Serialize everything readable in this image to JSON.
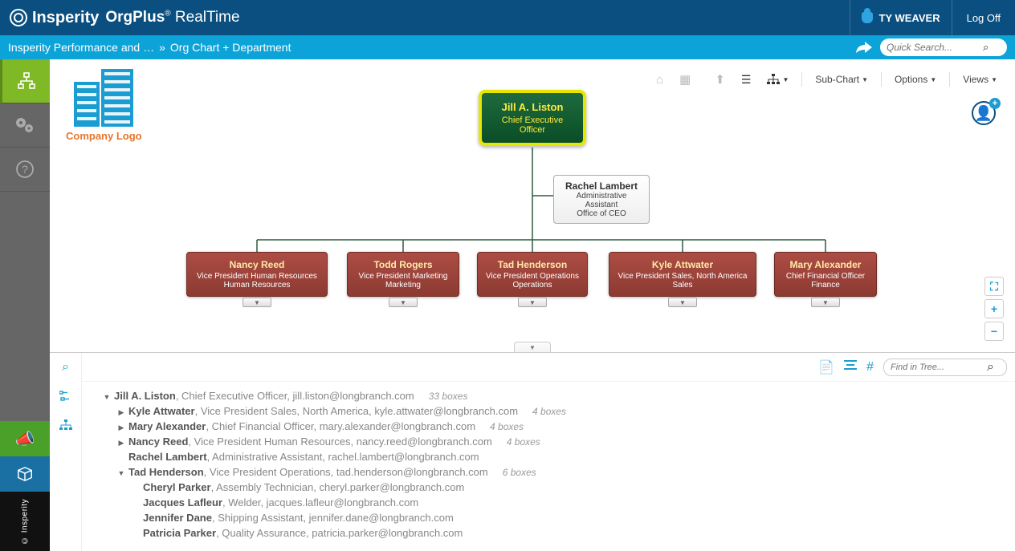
{
  "header": {
    "brand_main": "Insperity",
    "brand_product": "OrgPlus",
    "brand_suffix": "RealTime",
    "user_name": "TY WEAVER",
    "logoff": "Log Off"
  },
  "breadcrumb": {
    "item1": "Insperity Performance and …",
    "sep": "»",
    "item2": "Org Chart + Department"
  },
  "search": {
    "placeholder": "Quick Search..."
  },
  "logo_text": "Company Logo",
  "toolbar": {
    "subchart": "Sub-Chart",
    "options": "Options",
    "views": "Views"
  },
  "org": {
    "ceo": {
      "name": "Jill A. Liston",
      "title": "Chief Executive Officer"
    },
    "assistant": {
      "name": "Rachel Lambert",
      "title": "Administrative Assistant",
      "dept": "Office of CEO"
    },
    "vps": [
      {
        "name": "Nancy Reed",
        "title": "Vice President Human Resources",
        "dept": "Human Resources"
      },
      {
        "name": "Todd Rogers",
        "title": "Vice President Marketing",
        "dept": "Marketing"
      },
      {
        "name": "Tad Henderson",
        "title": "Vice President Operations",
        "dept": "Operations"
      },
      {
        "name": "Kyle Attwater",
        "title": "Vice President Sales, North America",
        "dept": "Sales"
      },
      {
        "name": "Mary Alexander",
        "title": "Chief Financial Officer",
        "dept": "Finance"
      }
    ]
  },
  "tree": {
    "search_placeholder": "Find in Tree...",
    "rows": [
      {
        "indent": 1,
        "arrow": "▼",
        "name": "Jill A. Liston",
        "details": ", Chief Executive Officer, jill.liston@longbranch.com",
        "boxes": "33 boxes"
      },
      {
        "indent": 2,
        "arrow": "▶",
        "name": "Kyle Attwater",
        "details": ", Vice President Sales, North America, kyle.attwater@longbranch.com",
        "boxes": "4 boxes"
      },
      {
        "indent": 2,
        "arrow": "▶",
        "name": "Mary Alexander",
        "details": ", Chief Financial Officer, mary.alexander@longbranch.com",
        "boxes": "4 boxes"
      },
      {
        "indent": 2,
        "arrow": "▶",
        "name": "Nancy Reed",
        "details": ", Vice President Human Resources, nancy.reed@longbranch.com",
        "boxes": "4 boxes"
      },
      {
        "indent": 2,
        "arrow": "",
        "name": "Rachel Lambert",
        "details": ", Administrative Assistant, rachel.lambert@longbranch.com",
        "boxes": ""
      },
      {
        "indent": 2,
        "arrow": "▼",
        "name": "Tad Henderson",
        "details": ", Vice President Operations, tad.henderson@longbranch.com",
        "boxes": "6 boxes"
      },
      {
        "indent": 3,
        "arrow": "",
        "name": "Cheryl Parker",
        "details": ", Assembly Technician, cheryl.parker@longbranch.com",
        "boxes": ""
      },
      {
        "indent": 3,
        "arrow": "",
        "name": "Jacques Lafleur",
        "details": ", Welder, jacques.lafleur@longbranch.com",
        "boxes": ""
      },
      {
        "indent": 3,
        "arrow": "",
        "name": "Jennifer Dane",
        "details": ", Shipping Assistant, jennifer.dane@longbranch.com",
        "boxes": ""
      },
      {
        "indent": 3,
        "arrow": "",
        "name": "Patricia Parker",
        "details": ", Quality Assurance, patricia.parker@longbranch.com",
        "boxes": ""
      }
    ]
  },
  "rail_copyright": "© Insperity"
}
